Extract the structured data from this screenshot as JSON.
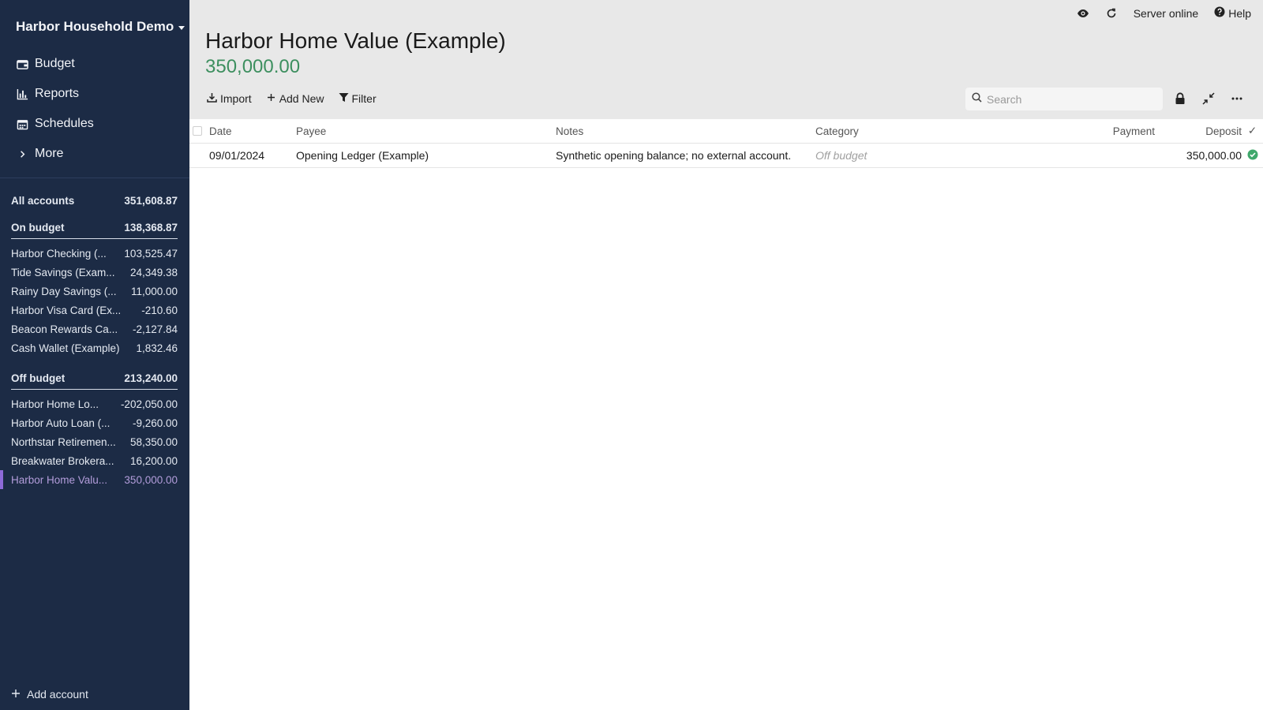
{
  "sidebar": {
    "budget_name": "Harbor Household Demo",
    "nav": [
      {
        "label": "Budget",
        "icon": "wallet-icon"
      },
      {
        "label": "Reports",
        "icon": "bar-chart-icon"
      },
      {
        "label": "Schedules",
        "icon": "calendar-icon"
      },
      {
        "label": "More",
        "icon": "chevron-right-icon"
      }
    ],
    "all_accounts": {
      "label": "All accounts",
      "balance": "351,608.87"
    },
    "on_budget": {
      "label": "On budget",
      "balance": "138,368.87",
      "accounts": [
        {
          "name": "Harbor Checking (...",
          "balance": "103,525.47"
        },
        {
          "name": "Tide Savings (Exam...",
          "balance": "24,349.38"
        },
        {
          "name": "Rainy Day Savings (...",
          "balance": "11,000.00"
        },
        {
          "name": "Harbor Visa Card (Ex...",
          "balance": "-210.60"
        },
        {
          "name": "Beacon Rewards Ca...",
          "balance": "-2,127.84"
        },
        {
          "name": "Cash Wallet (Example)",
          "balance": "1,832.46"
        }
      ]
    },
    "off_budget": {
      "label": "Off budget",
      "balance": "213,240.00",
      "accounts": [
        {
          "name": "Harbor Home Lo...",
          "balance": "-202,050.00"
        },
        {
          "name": "Harbor Auto Loan (...",
          "balance": "-9,260.00"
        },
        {
          "name": "Northstar Retiremen...",
          "balance": "58,350.00"
        },
        {
          "name": "Breakwater Brokera...",
          "balance": "16,200.00"
        },
        {
          "name": "Harbor Home Valu...",
          "balance": "350,000.00"
        }
      ]
    },
    "add_account": "Add account"
  },
  "topbar": {
    "server_status": "Server online",
    "help": "Help"
  },
  "account": {
    "title": "Harbor Home Value (Example)",
    "balance": "350,000.00"
  },
  "toolbar": {
    "import": "Import",
    "add_new": "Add New",
    "filter": "Filter",
    "search_placeholder": "Search"
  },
  "table": {
    "columns": {
      "date": "Date",
      "payee": "Payee",
      "notes": "Notes",
      "category": "Category",
      "payment": "Payment",
      "deposit": "Deposit",
      "cleared": "✓"
    },
    "rows": [
      {
        "date": "09/01/2024",
        "payee": "Opening Ledger (Example)",
        "notes": "Synthetic opening balance; no external account.",
        "category": "Off budget",
        "payment": "",
        "deposit": "350,000.00",
        "cleared": true
      }
    ]
  },
  "colors": {
    "sidebar_bg": "#1c2b45",
    "selected_account": "#b39ddb",
    "balance_green": "#3d8f5f",
    "cleared_green": "#3fa86b"
  }
}
